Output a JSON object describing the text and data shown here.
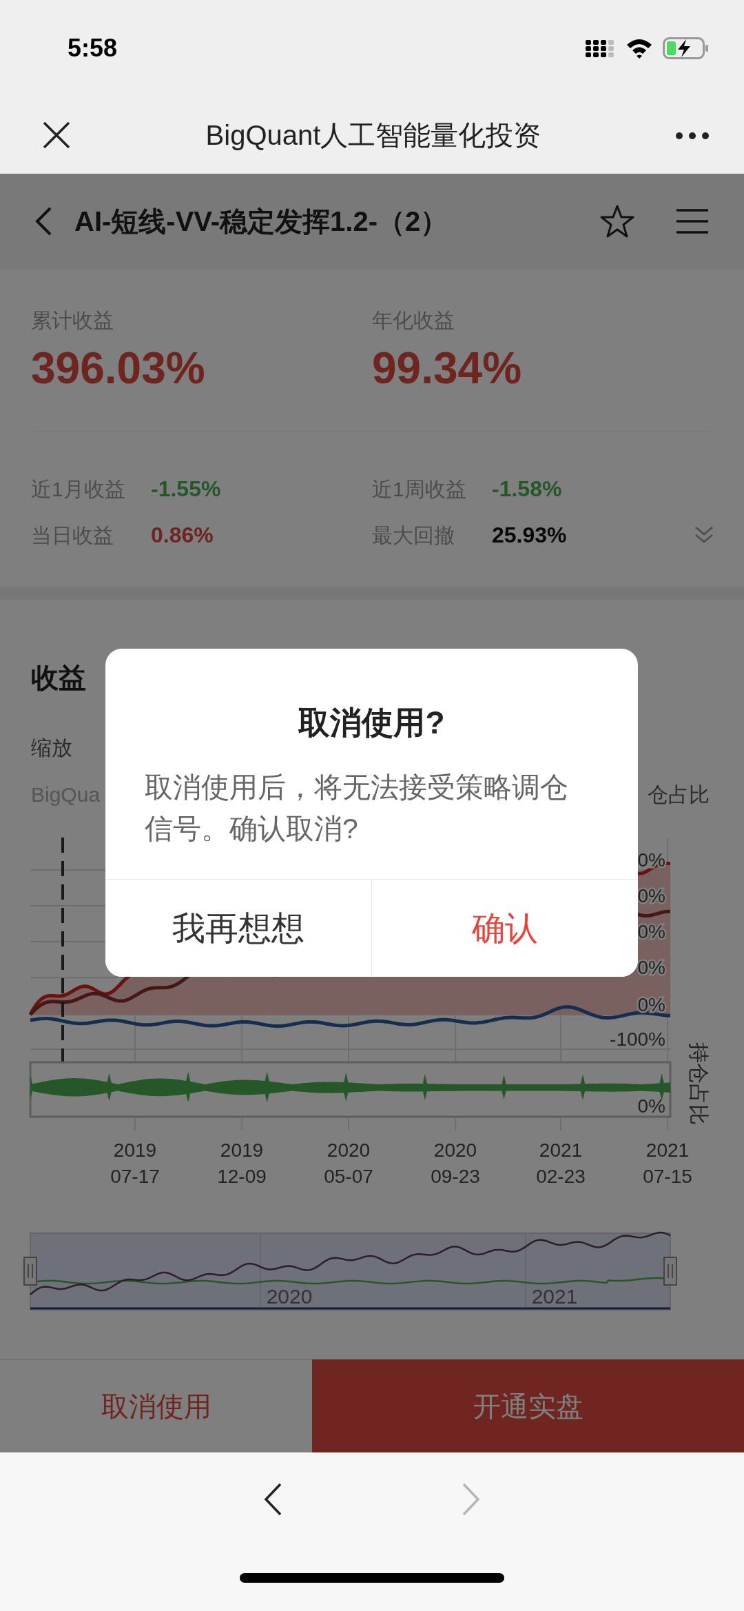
{
  "status_bar": {
    "time": "5:58"
  },
  "browser": {
    "title": "BigQuant人工智能量化投资"
  },
  "page_header": {
    "title": "AI-短线-VV-稳定发挥1.2-（2）",
    "favorite": false
  },
  "stats": {
    "primary": [
      {
        "label": "累计收益",
        "value": "396.03%",
        "kind": "gain"
      },
      {
        "label": "年化收益",
        "value": "99.34%",
        "kind": "gain"
      }
    ],
    "secondary": [
      {
        "label": "近1月收益",
        "value": "-1.55%",
        "kind": "loss"
      },
      {
        "label": "近1周收益",
        "value": "-1.58%",
        "kind": "loss"
      },
      {
        "label": "当日收益",
        "value": "0.86%",
        "kind": "gain"
      },
      {
        "label": "最大回撤",
        "value": "25.93%",
        "kind": "plain"
      }
    ],
    "expanded": false
  },
  "chart_section": {
    "heading": "收益",
    "zoom_label": "缩放",
    "legend_left": "BigQua",
    "legend_right": "仓占比",
    "y_ticks": [
      "0%",
      "0%",
      "0%",
      "0%",
      "0%",
      "-100%"
    ],
    "position_tick": "0%",
    "position_axis_title": "持仓占比",
    "x_ticks": [
      {
        "year": "2019",
        "date": "07-17"
      },
      {
        "year": "2019",
        "date": "12-09"
      },
      {
        "year": "2020",
        "date": "05-07"
      },
      {
        "year": "2020",
        "date": "09-23"
      },
      {
        "year": "2021",
        "date": "02-23"
      },
      {
        "year": "2021",
        "date": "07-15"
      }
    ],
    "navigator_labels": [
      "2020",
      "2021"
    ]
  },
  "actions": [
    {
      "label": "取消使用",
      "kind": "secondary"
    },
    {
      "label": "开通实盘",
      "kind": "primary"
    }
  ],
  "dialog": {
    "title": "取消使用?",
    "message": "取消使用后，将无法接受策略调仓信号。确认取消?",
    "buttons": [
      {
        "label": "我再想想",
        "kind": "cancel"
      },
      {
        "label": "确认",
        "kind": "confirm"
      }
    ]
  },
  "browser_nav": {
    "back_enabled": true,
    "forward_enabled": false
  }
}
